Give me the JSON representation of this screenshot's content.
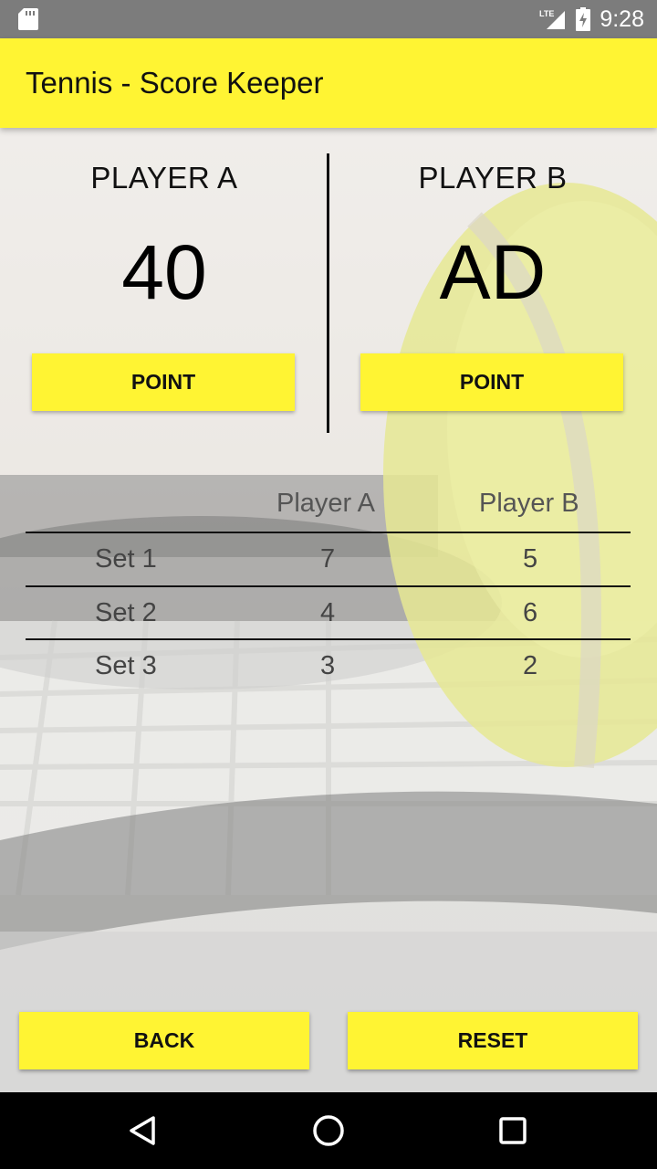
{
  "status_bar": {
    "time": "9:28",
    "network": "LTE",
    "icons": [
      "sd-card-icon",
      "lte-signal-icon",
      "battery-charging-icon"
    ]
  },
  "app_bar": {
    "title": "Tennis - Score Keeper"
  },
  "scoreboard": {
    "player_a": {
      "name": "PLAYER A",
      "score": "40",
      "button_label": "POINT"
    },
    "player_b": {
      "name": "PLAYER B",
      "score": "AD",
      "button_label": "POINT"
    }
  },
  "sets": {
    "headers": [
      "Player A",
      "Player B"
    ],
    "rows": [
      {
        "label": "Set 1",
        "player_a": "7",
        "player_b": "5"
      },
      {
        "label": "Set 2",
        "player_a": "4",
        "player_b": "6"
      },
      {
        "label": "Set 3",
        "player_a": "3",
        "player_b": "2"
      }
    ]
  },
  "actions": {
    "back_label": "BACK",
    "reset_label": "RESET"
  },
  "navigation": {
    "icons": [
      "nav-back-icon",
      "nav-home-icon",
      "nav-recents-icon"
    ]
  },
  "colors": {
    "accent": "#fff433",
    "status_bar": "#7c7c7c",
    "nav_bar": "#000000"
  }
}
